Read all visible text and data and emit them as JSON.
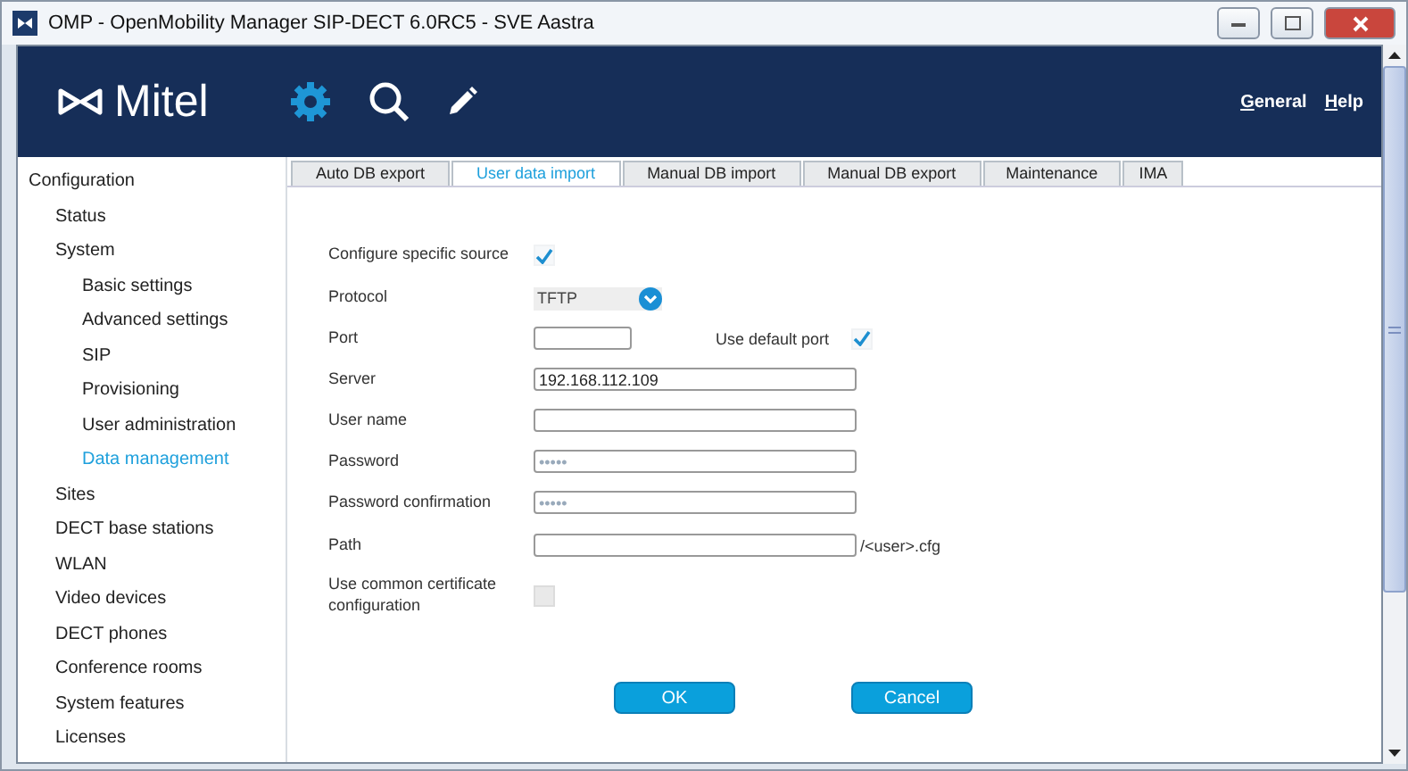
{
  "window": {
    "title": "OMP - OpenMobility Manager SIP-DECT 6.0RC5 - SVE Aastra"
  },
  "header": {
    "logo": "Mitel",
    "links": [
      {
        "label": "General"
      },
      {
        "label": "Help"
      }
    ]
  },
  "sidebar": {
    "items": [
      {
        "label": "Configuration",
        "selected": false,
        "children": [
          {
            "label": "Status",
            "selected": false
          },
          {
            "label": "System",
            "selected": false,
            "children": [
              {
                "label": "Basic settings",
                "selected": false
              },
              {
                "label": "Advanced settings",
                "selected": false
              },
              {
                "label": "SIP",
                "selected": false
              },
              {
                "label": "Provisioning",
                "selected": false
              },
              {
                "label": "User administration",
                "selected": false
              },
              {
                "label": "Data management",
                "selected": true
              }
            ]
          },
          {
            "label": "Sites",
            "selected": false
          },
          {
            "label": "DECT base stations",
            "selected": false
          },
          {
            "label": "WLAN",
            "selected": false
          },
          {
            "label": "Video devices",
            "selected": false
          },
          {
            "label": "DECT phones",
            "selected": false
          },
          {
            "label": "Conference rooms",
            "selected": false
          },
          {
            "label": "System features",
            "selected": false
          },
          {
            "label": "Licenses",
            "selected": false
          }
        ]
      }
    ]
  },
  "tabs": [
    {
      "label": "Auto DB export",
      "selected": false
    },
    {
      "label": "User data import",
      "selected": true
    },
    {
      "label": "Manual DB import",
      "selected": false
    },
    {
      "label": "Manual DB export",
      "selected": false
    },
    {
      "label": "Maintenance",
      "selected": false
    },
    {
      "label": "IMA",
      "selected": false
    }
  ],
  "form": {
    "rows": [
      {
        "kind": "checkbox",
        "label": "Configure specific source",
        "checked": true,
        "disabled": false
      },
      {
        "kind": "select",
        "label": "Protocol",
        "value": "TFTP"
      },
      {
        "kind": "port",
        "label": "Port",
        "value": "",
        "extra_label": "Use default port",
        "checked": true
      },
      {
        "kind": "text",
        "label": "Server",
        "value": "192.168.112.109"
      },
      {
        "kind": "text",
        "label": "User name",
        "value": ""
      },
      {
        "kind": "password",
        "label": "Password",
        "value": "•••••"
      },
      {
        "kind": "password",
        "label": "Password confirmation",
        "value": "•••••"
      },
      {
        "kind": "suffix",
        "label": "Path",
        "value": "",
        "suffix": "/<user>.cfg"
      },
      {
        "kind": "checkbox",
        "label": "Use common certificate configuration",
        "checked": false,
        "disabled": true
      }
    ],
    "buttons": [
      {
        "label": "OK"
      },
      {
        "label": "Cancel"
      }
    ]
  }
}
